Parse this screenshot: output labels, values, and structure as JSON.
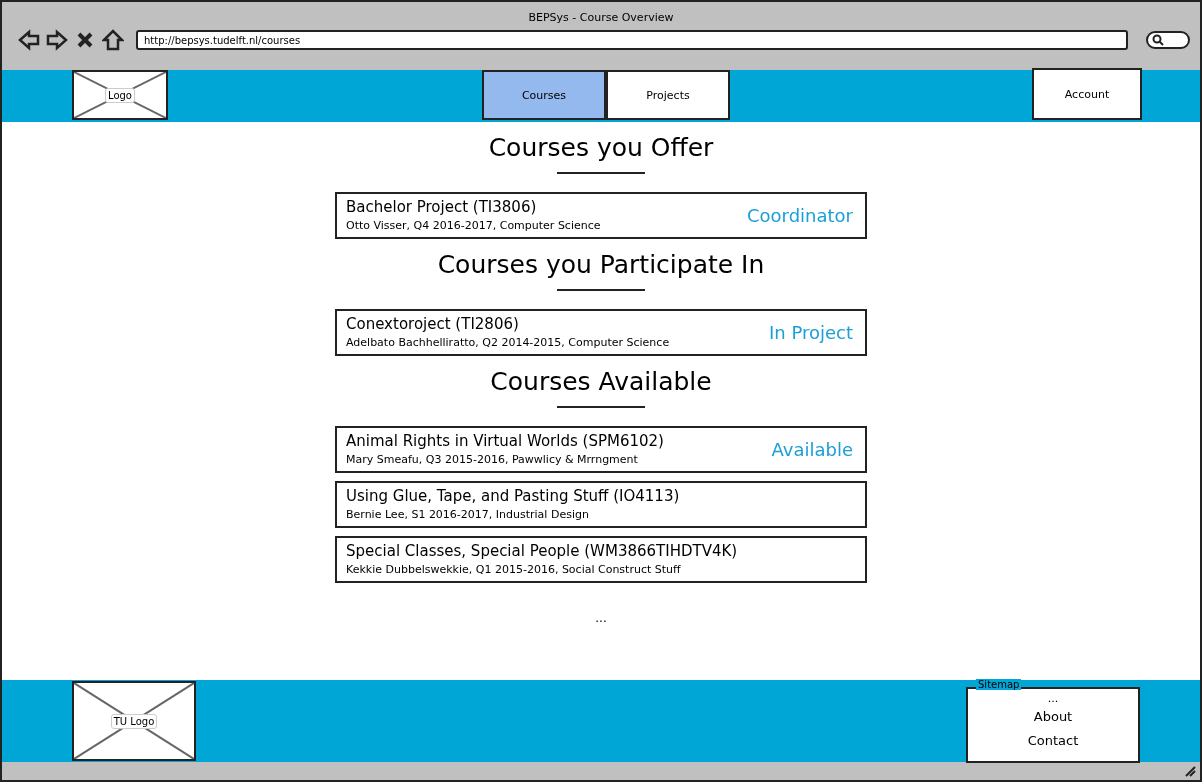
{
  "window": {
    "title": "BEPSys - Course Overview",
    "url": "http://bepsys.tudelft.nl/courses"
  },
  "header": {
    "logo": "Logo",
    "tabs": [
      {
        "label": "Courses",
        "selected": true
      },
      {
        "label": "Projects",
        "selected": false
      }
    ],
    "account": "Account"
  },
  "sections": [
    {
      "title": "Courses you Offer",
      "courses": [
        {
          "name": "Bachelor Project (TI3806)",
          "details": "Otto Visser, Q4 2016-2017, Computer Science",
          "status": "Coordinator"
        }
      ]
    },
    {
      "title": "Courses you Participate In",
      "courses": [
        {
          "name": "Conextoroject (TI2806)",
          "details": "Adelbato Bachhelliratto, Q2 2014-2015, Computer Science",
          "status": "In Project"
        }
      ]
    },
    {
      "title": "Courses Available",
      "courses": [
        {
          "name": "Animal Rights in Virtual Worlds (SPM6102)",
          "details": "Mary Smeafu, Q3 2015-2016, Pawwlicy & Mrrngment",
          "status": "Available"
        },
        {
          "name": "Using Glue, Tape, and Pasting Stuff (IO4113)",
          "details": "Bernie Lee, S1 2016-2017, Industrial Design"
        },
        {
          "name": "Special Classes, Special People (WM3866TIHDTV4K)",
          "details": "Kekkie Dubbelswekkie, Q1 2015-2016, Social Construct Stuff"
        }
      ]
    }
  ],
  "more": "...",
  "footer": {
    "logo": "TU Logo",
    "sitemap": {
      "title": "Sitemap",
      "items": [
        "...",
        "About",
        "Contact"
      ]
    }
  }
}
